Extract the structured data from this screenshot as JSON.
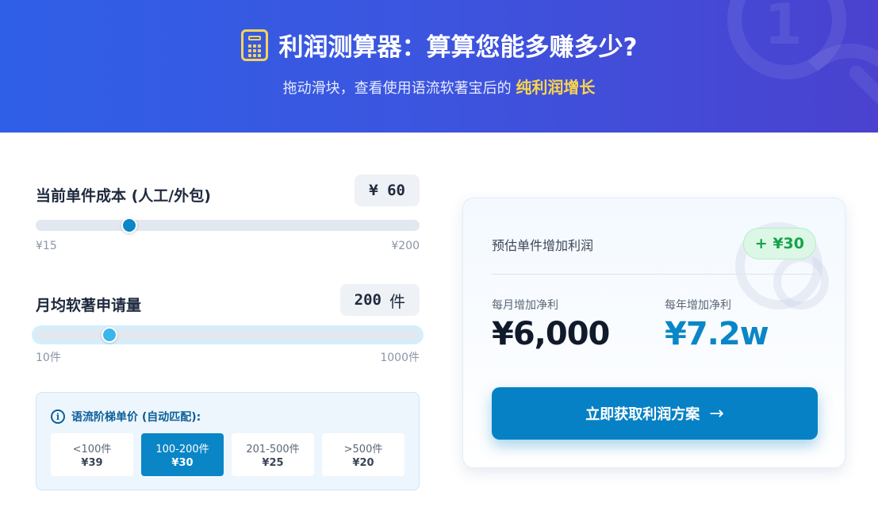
{
  "header": {
    "title": "利润测算器：算算您能多赚多少?",
    "subtitle_prefix": "拖动滑块，查看使用语流软著宝后的",
    "subtitle_highlight": "纯利润增长",
    "icon": "calculator-icon"
  },
  "cost_slider": {
    "label": "当前单件成本 (人工/外包)",
    "value_display": "¥ 60",
    "value": 60,
    "min": 15,
    "max": 200,
    "min_label": "¥15",
    "max_label": "¥200"
  },
  "volume_slider": {
    "label": "月均软著申请量",
    "value_display": "200",
    "unit": "件",
    "value": 200,
    "min": 10,
    "max": 1000,
    "min_label": "10件",
    "max_label": "1000件"
  },
  "tiers": {
    "title": "语流阶梯单价 (自动匹配):",
    "items": [
      {
        "range": "<100件",
        "price": "¥39",
        "active": false
      },
      {
        "range": "100-200件",
        "price": "¥30",
        "active": true
      },
      {
        "range": "201-500件",
        "price": "¥25",
        "active": false
      },
      {
        "range": ">500件",
        "price": "¥20",
        "active": false
      }
    ]
  },
  "result": {
    "unit_profit_label": "预估单件增加利润",
    "unit_profit_value": "+ ¥30",
    "monthly_label": "每月增加净利",
    "monthly_value": "¥6,000",
    "yearly_label": "每年增加净利",
    "yearly_value": "¥7.2w",
    "cta_label": "立即获取利润方案",
    "cta_arrow": "→"
  },
  "colors": {
    "accent": "#0a86c7",
    "highlight": "#f9d649",
    "gain": "#16a34a"
  }
}
